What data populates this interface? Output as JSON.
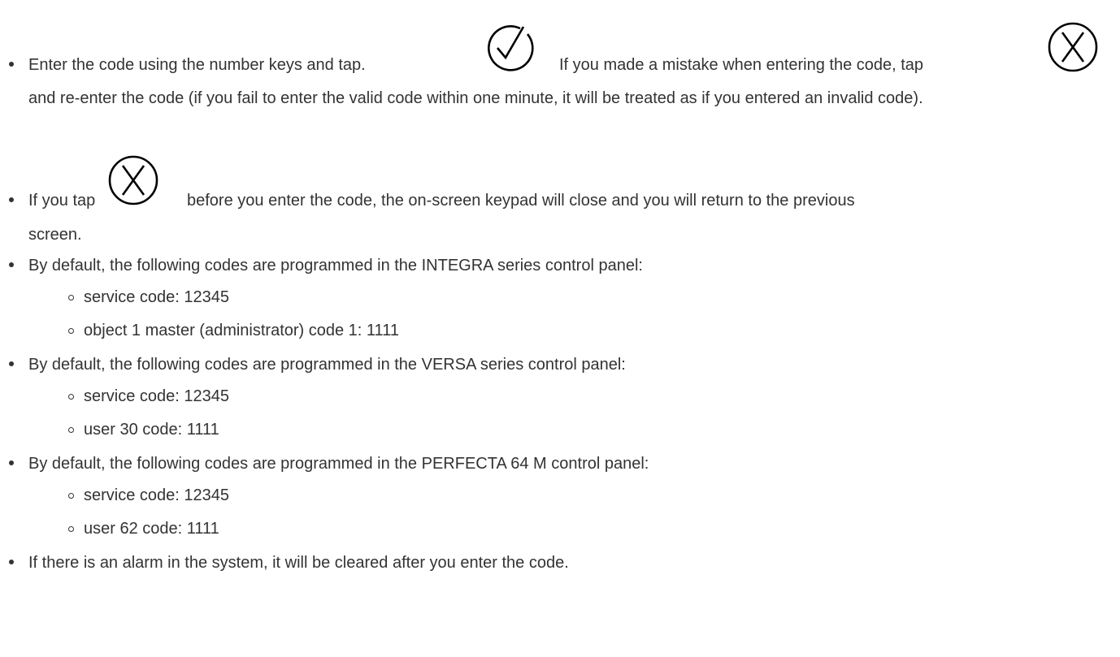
{
  "items": [
    {
      "before_icon1": "Enter the code using the number keys and tap.",
      "icon1": "check-circle-icon",
      "between_icons": "If you made a mistake when entering the code, tap",
      "icon2": "x-circle-icon",
      "after_icon2": "and re-enter the code (if you fail to enter the valid code within one minute, it will be treated as if you entered an invalid code)."
    },
    {
      "before_icon": "If you tap",
      "icon": "x-circle-icon",
      "after_icon": "before you enter the code, the on-screen keypad will close and you will return to the previous screen."
    },
    {
      "text": "By default, the following codes are programmed in the INTEGRA series control panel:",
      "sub": [
        "service code: 12345",
        "object 1 master (administrator) code 1: 1111"
      ]
    },
    {
      "text": "By default, the following codes are programmed in the VERSA series control panel:",
      "sub": [
        "service code: 12345",
        "user 30 code: 1111"
      ]
    },
    {
      "text": "By default, the following codes are programmed in the PERFECTA 64 M control panel:",
      "sub": [
        "service code: 12345",
        "user 62 code: 1111"
      ]
    },
    {
      "text": "If there is an alarm in the system, it will be cleared after you enter the code."
    }
  ]
}
